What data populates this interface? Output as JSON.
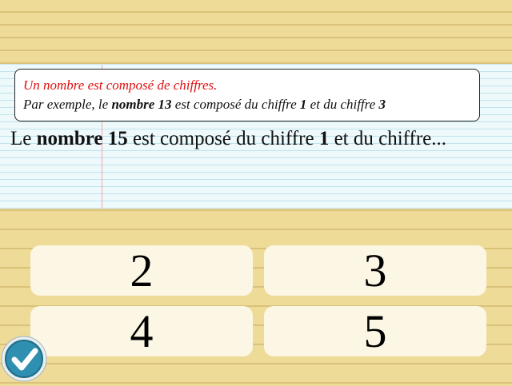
{
  "hint": {
    "line1": "Un nombre est composé de chiffres.",
    "line2": {
      "part1": "Par exemple, le ",
      "bold1": "nombre 13",
      "part2": " est composé du chiffre ",
      "bold2": "1",
      "part3": " et du chiffre ",
      "bold3": "3"
    }
  },
  "question": {
    "part1": "Le ",
    "bold1": "nombre 15",
    "part2": " est composé du chiffre ",
    "bold2": "1",
    "part3": " et du chiffre..."
  },
  "answers": [
    "2",
    "3",
    "4",
    "5"
  ],
  "check_button": {
    "icon": "checkmark-icon",
    "color": "#2e8fb0"
  },
  "colors": {
    "hint_first_line": "#e01010",
    "background_paper": "#efdb98",
    "notebook": "#eef9fb",
    "answer_tile": "#fcf6e4"
  }
}
